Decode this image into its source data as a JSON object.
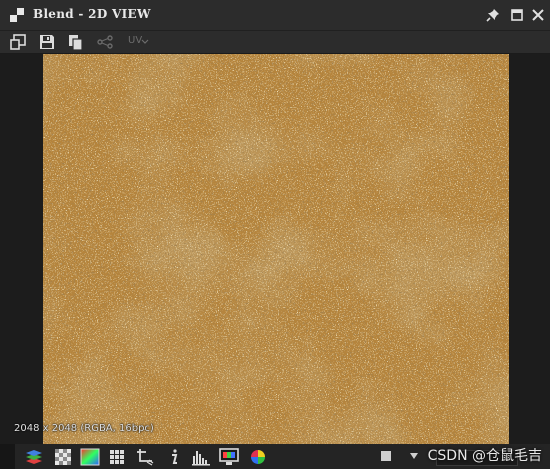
{
  "window": {
    "title": "Blend - 2D VIEW"
  },
  "toolbar": {
    "uv_label": "UV"
  },
  "viewport": {
    "resolution_label": "2048 x 2048 (RGBA, 16bpc)"
  },
  "statusbar": {
    "watermark": "CSDN @仓鼠毛吉"
  },
  "icons": [
    "checker-icon",
    "pin-icon",
    "restore-icon",
    "close-icon",
    "fit-view-icon",
    "save-icon",
    "copy-icon",
    "link-icon",
    "layers-icon",
    "transparency-icon",
    "color-channels-icon",
    "grid-icon",
    "crop-icon",
    "info-icon",
    "histogram-icon",
    "display-icon",
    "color-wheel-icon",
    "nav-prev-icon",
    "nav-next-icon"
  ],
  "colors": {
    "titlebar": "#2c2c2c",
    "viewport_bg": "#1c1c1c",
    "sand_base": "#b8873d",
    "sand_light": "#e3c27a",
    "sand_dark": "#7a5524"
  }
}
